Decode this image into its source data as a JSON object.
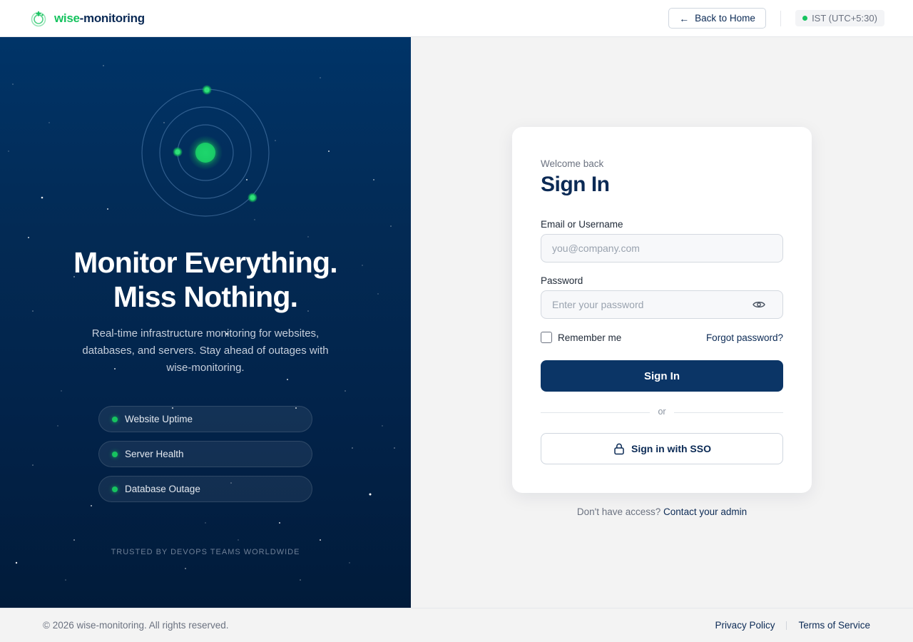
{
  "header": {
    "brand": {
      "prefix": "wise",
      "suffix": "-monitoring",
      "icon": "logo-icon"
    },
    "back_button": {
      "arrow": "←",
      "label": "Back to Home"
    },
    "timezone": {
      "label": "IST (UTC+5:30)",
      "status_color": "#16c35f"
    }
  },
  "hero": {
    "title_line1": "Monitor Everything.",
    "title_line2": "Miss Nothing.",
    "subtitle": "Real-time infrastructure monitoring for websites, databases, and servers. Stay ahead of outages with wise-monitoring.",
    "features": [
      {
        "label": "Website Uptime"
      },
      {
        "label": "Server Health"
      },
      {
        "label": "Database Outage"
      }
    ],
    "trusted": "TRUSTED BY DEVOPS TEAMS WORLDWIDE"
  },
  "login": {
    "welcome": "Welcome back",
    "title": "Sign In",
    "email": {
      "label": "Email or Username",
      "placeholder": "you@company.com",
      "value": ""
    },
    "password": {
      "label": "Password",
      "placeholder": "Enter your password",
      "value": ""
    },
    "remember_label": "Remember me",
    "forgot_label": "Forgot password?",
    "submit_label": "Sign In",
    "divider": "or",
    "sso_label": "Sign in with SSO"
  },
  "access": {
    "text": "Don't have access?",
    "link": "Contact your admin"
  },
  "footer": {
    "copyright": "© 2026 wise-monitoring. All rights reserved.",
    "privacy": "Privacy Policy",
    "terms": "Terms of Service"
  },
  "colors": {
    "brand_navy": "#0b2a55",
    "accent_green": "#16c35f",
    "button_navy": "#0b3566"
  }
}
